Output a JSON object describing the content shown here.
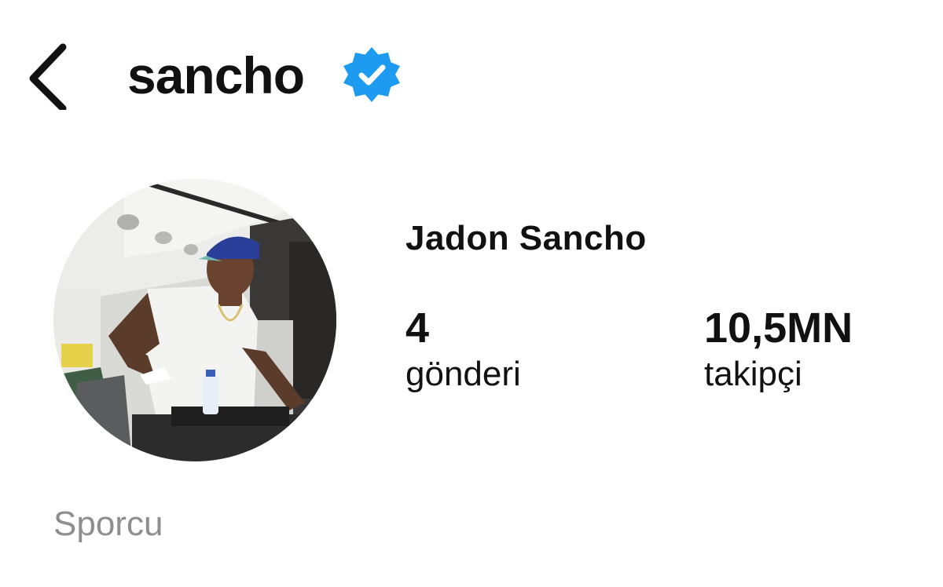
{
  "header": {
    "username": "sancho",
    "back_icon": "chevron-left-icon",
    "verified_icon": "verified-badge-icon",
    "verified_color": "#1d9bf0"
  },
  "profile": {
    "full_name": "Jadon Sancho",
    "stats": [
      {
        "value": "4",
        "label": "gönderi"
      },
      {
        "value": "10,5MN",
        "label": "takipçi"
      }
    ],
    "category": "Sporcu"
  }
}
